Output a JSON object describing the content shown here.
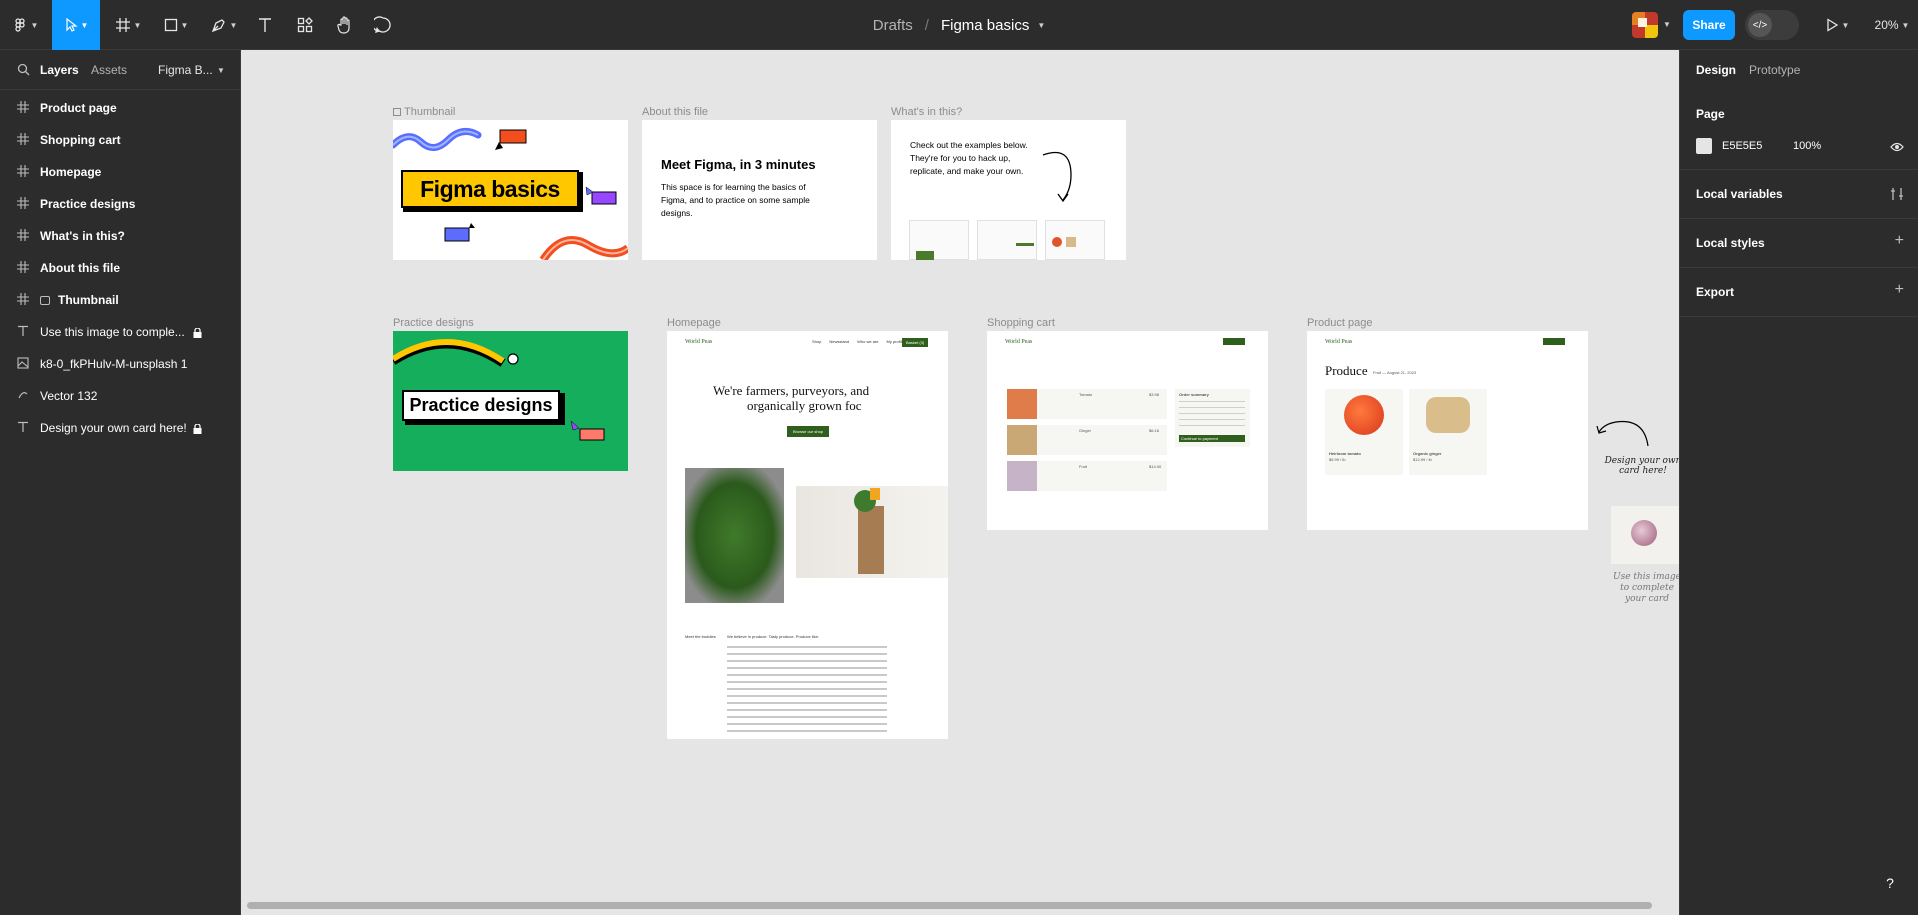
{
  "toolbar": {
    "breadcrumb_drafts": "Drafts",
    "slash": "/",
    "file_name": "Figma basics",
    "share_label": "Share",
    "zoom": "20%",
    "devmode_glyph": "</>",
    "tools": [
      "figma-menu-icon",
      "move-icon",
      "frame-icon",
      "rectangle-icon",
      "pen-icon",
      "text-icon",
      "resources-icon",
      "hand-icon",
      "comment-icon"
    ]
  },
  "left_panel": {
    "tabs": {
      "layers": "Layers",
      "assets": "Assets",
      "page": "Figma B..."
    },
    "layers": [
      {
        "label": "Product page",
        "icon": "frame-icon",
        "bold": true,
        "locked": false
      },
      {
        "label": "Shopping cart",
        "icon": "frame-icon",
        "bold": true,
        "locked": false
      },
      {
        "label": "Homepage",
        "icon": "frame-icon",
        "bold": true,
        "locked": false
      },
      {
        "label": "Practice designs",
        "icon": "frame-icon",
        "bold": true,
        "locked": false
      },
      {
        "label": "What's in this?",
        "icon": "frame-icon",
        "bold": true,
        "locked": false
      },
      {
        "label": "About this file",
        "icon": "frame-icon",
        "bold": true,
        "locked": false
      },
      {
        "label": "Thumbnail",
        "icon": "frame-icon",
        "bold": true,
        "locked": false
      },
      {
        "label": "Use this image to comple...",
        "icon": "text-icon",
        "bold": false,
        "locked": true
      },
      {
        "label": "k8-0_fkPHulv-M-unsplash 1",
        "icon": "image-icon",
        "bold": false,
        "locked": false
      },
      {
        "label": "Vector 132",
        "icon": "vector-icon",
        "bold": false,
        "locked": false
      },
      {
        "label": "Design your own card here!",
        "icon": "text-icon",
        "bold": false,
        "locked": true
      }
    ]
  },
  "canvas": {
    "frames": {
      "thumbnail": {
        "label": "Thumbnail",
        "title": "Figma basics"
      },
      "about": {
        "label": "About this file",
        "heading": "Meet Figma, in 3 minutes",
        "body": "This space is for learning the basics of Figma, and to practice on some sample designs."
      },
      "whats_in": {
        "label": "What's in this?",
        "body": "Check out the examples below. They're for you to hack up, replicate, and make your own."
      },
      "practice": {
        "label": "Practice designs",
        "title": "Practice designs"
      },
      "homepage": {
        "label": "Homepage",
        "brand": "World Peas",
        "headline_1": "We're farmers, purveyors, and",
        "headline_2": "organically grown foc",
        "cta": "Browse our shop",
        "paragraph_label": "Meet the buddies",
        "paragraph": "We believe in produce. Tasty produce. Produce like:",
        "nav": [
          "Shop",
          "Newsstand",
          "Who we are",
          "My profile"
        ],
        "basket": "Basket (3)"
      },
      "cart": {
        "label": "Shopping cart",
        "brand": "World Peas",
        "summary_title": "Order summary",
        "items": [
          "Tomato",
          "Ginger",
          "Fruit"
        ],
        "prices": [
          "$3.98",
          "$6.16",
          "$14.00"
        ],
        "checkout": "Continue to payment"
      },
      "product": {
        "label": "Product page",
        "brand": "World Peas",
        "heading": "Produce",
        "subheading": "Fruit — August 21, 2023",
        "items": [
          {
            "name": "Heirloom tomato",
            "price": "$5.99 / lb"
          },
          {
            "name": "Organic ginger",
            "price": "$12.99 / lb"
          }
        ]
      }
    },
    "side_note_1": "Design your own card here!",
    "side_note_2": "Use this image to complete your card"
  },
  "right_panel": {
    "tabs": {
      "design": "Design",
      "prototype": "Prototype"
    },
    "page_title": "Page",
    "page_color": "E5E5E5",
    "page_opacity": "100%",
    "local_variables": "Local variables",
    "local_styles": "Local styles",
    "export": "Export"
  },
  "help": "?",
  "colors": {
    "accent": "#0d99ff",
    "panel": "#2c2c2c",
    "canvas": "#e5e5e5",
    "green": "#14ae5c",
    "yellow": "#ffc700"
  }
}
